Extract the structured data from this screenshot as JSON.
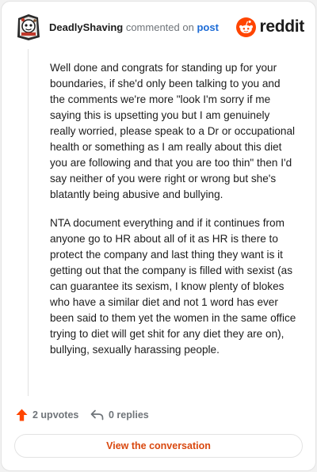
{
  "comment": {
    "username": "DeadlyShaving",
    "action_text": "commented on",
    "target_link": "post",
    "paragraphs": [
      "Well done and congrats for standing up for your boundaries, if she'd only been talking to you and the comments we're more \"look I'm sorry if me saying this is upsetting you but I am genuinely really worried, please speak to a Dr or occupational health or something as I am really about this diet you are following and that you are too thin\" then I'd say neither of you were right or wrong but she's blatantly being abusive and bullying.",
      "NTA document everything and if it continues from anyone go to HR about all of it as HR is there to protect the company and last thing they want is it getting out that the company is filled with sexist (as can guarantee its sexism, I know plenty of blokes who have a similar diet and not 1 word has ever been said to them yet the women in the same office trying to diet will get shit for any diet they are on), bullying, sexually harassing people."
    ],
    "upvotes": "2 upvotes",
    "replies": "0 replies"
  },
  "brand": {
    "name": "reddit",
    "accent": "#ff4500"
  },
  "actions": {
    "view_conversation": "View the conversation"
  },
  "icons": {
    "avatar": "avatar-icon",
    "logo": "reddit-logo-icon",
    "upvote": "upvote-arrow-icon",
    "reply": "reply-arrow-icon"
  },
  "colors": {
    "upvote": "#ff4500",
    "link": "#1c6bd6",
    "button_text": "#d9480f",
    "muted": "#6f7479"
  }
}
